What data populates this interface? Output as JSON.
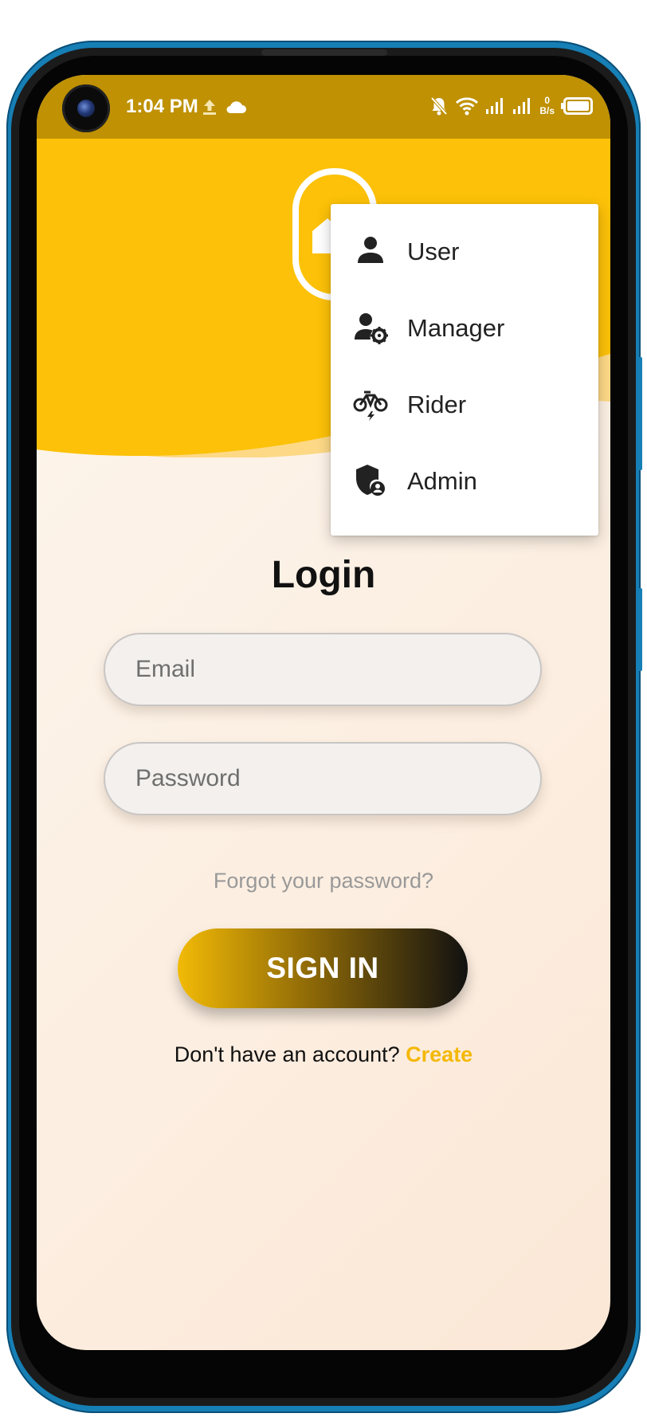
{
  "status_bar": {
    "time": "1:04 PM",
    "icons": [
      "upload-icon",
      "cloud-icon",
      "bell-off-icon",
      "wifi-icon",
      "signal-icon",
      "signal-icon",
      "battery-icon"
    ],
    "net_speed_value": "0",
    "net_speed_unit": "B/s"
  },
  "header": {
    "logo_icon": "house-icon",
    "menu_icon": "more-vert-icon",
    "accent_color": "#fcc108",
    "wave_light_color": "#fdd986"
  },
  "menu": {
    "items": [
      {
        "label": "User",
        "icon": "person-icon"
      },
      {
        "label": "Manager",
        "icon": "manager-icon"
      },
      {
        "label": "Rider",
        "icon": "bicycle-icon"
      },
      {
        "label": "Admin",
        "icon": "admin-shield-icon"
      }
    ]
  },
  "login": {
    "title": "Login",
    "email_placeholder": "Email",
    "password_placeholder": "Password",
    "forgot_text": "Forgot your password?",
    "signin_label": "SIGN IN",
    "signup_prompt": "Don't have an account?",
    "signup_link": "Create"
  }
}
